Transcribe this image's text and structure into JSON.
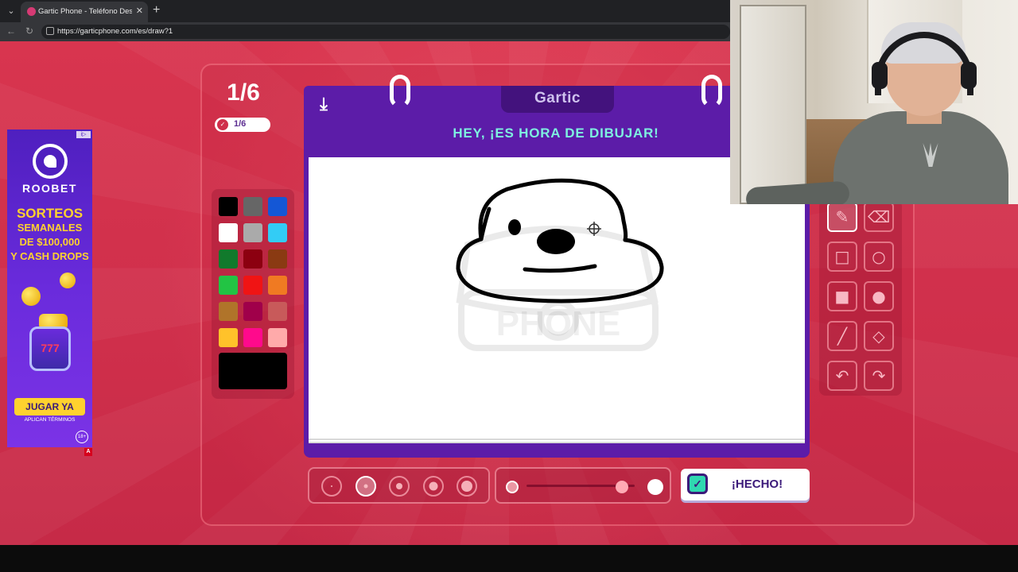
{
  "browser": {
    "tab_title": "Gartic Phone - Teléfono Descomp",
    "tab_close": "✕",
    "new_tab": "+",
    "tab_menu": "⌄",
    "back": "←",
    "reload": "↻",
    "url": "https://garticphone.com/es/draw?1"
  },
  "ad": {
    "brand": "ROOBET",
    "promo_line1": "SORTEOS",
    "promo_line2": "SEMANALES",
    "promo_line3": "DE $100,000",
    "promo_line4": "Y CASH DROPS",
    "slot_text": "777",
    "cta": "JUGAR YA",
    "terms": "APLICAN TÉRMINOS",
    "age": "18+",
    "mark": "A",
    "info": "i▷"
  },
  "round": {
    "big": "1/6",
    "pill": "1/6",
    "pill_icon": "✓"
  },
  "palette": {
    "swatches": [
      "#000000",
      "#666666",
      "#1457d6",
      "#ffffff",
      "#aaaaaa",
      "#33ccf5",
      "#117a2c",
      "#8c0010",
      "#8a3a12",
      "#22c444",
      "#f01414",
      "#f07a22",
      "#b0742a",
      "#a0004a",
      "#c85a5a",
      "#ffc22a",
      "#ff0a8c",
      "#ffaaaa"
    ],
    "current": "#000000"
  },
  "board": {
    "logo": "Gartic",
    "title": "HEY, ¡ES HORA DE DIBUJAR!",
    "watermark": "PHONE",
    "save_icon": "⤓"
  },
  "tools": {
    "items": [
      {
        "name": "pencil-tool",
        "icon": "pencil-icon",
        "active": true
      },
      {
        "name": "eraser-tool",
        "icon": "eraser-icon",
        "active": false
      },
      {
        "name": "rectangle-tool",
        "icon": "square-outline-icon",
        "active": false
      },
      {
        "name": "ellipse-tool",
        "icon": "circle-outline-icon",
        "active": false
      },
      {
        "name": "filled-rectangle-tool",
        "icon": "square-filled-icon",
        "active": false
      },
      {
        "name": "filled-ellipse-tool",
        "icon": "circle-filled-icon",
        "active": false
      },
      {
        "name": "line-tool",
        "icon": "line-icon",
        "active": false
      },
      {
        "name": "fill-tool",
        "icon": "bucket-icon",
        "active": false
      },
      {
        "name": "undo-tool",
        "icon": "undo-icon",
        "active": false
      },
      {
        "name": "redo-tool",
        "icon": "redo-icon",
        "active": false
      }
    ]
  },
  "brush_sizes": {
    "selected_index": 1,
    "count": 5
  },
  "opacity": {
    "value": 0.88
  },
  "done": {
    "label": "¡HECHO!",
    "icon": "✓"
  }
}
